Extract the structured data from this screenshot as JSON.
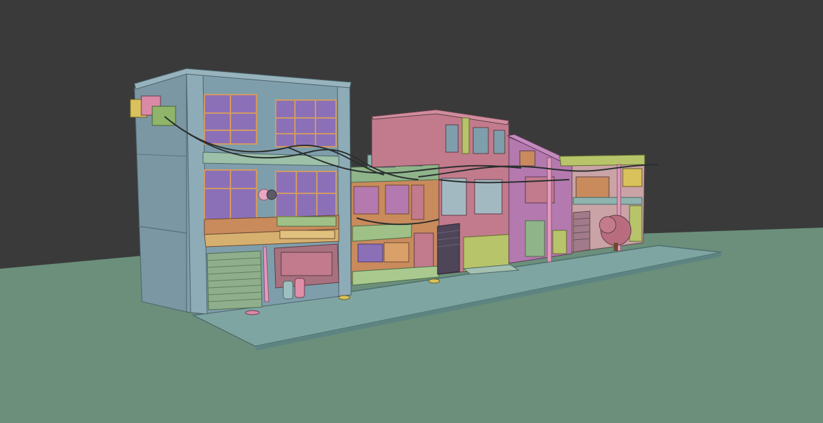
{
  "viewport": {
    "background_color": "#3a3a3a",
    "ground_color": "#6b8f7b"
  },
  "scene": {
    "signs": {
      "main_sign_text": "",
      "lower_sign_text": ""
    }
  },
  "colors": {
    "building_blue": "#7f9eab",
    "building_blue_dark": "#6a8793",
    "window_purple": "#8b70b8",
    "building_pink": "#c27b8c",
    "building_magenta": "#b479ae",
    "building_green": "#8fb48a",
    "building_orange": "#c98a5c",
    "yellow_green": "#b8c46a",
    "pavement": "#7fa5a3",
    "shutter_green": "#8faf8c",
    "cable": "#2a2f2f"
  }
}
